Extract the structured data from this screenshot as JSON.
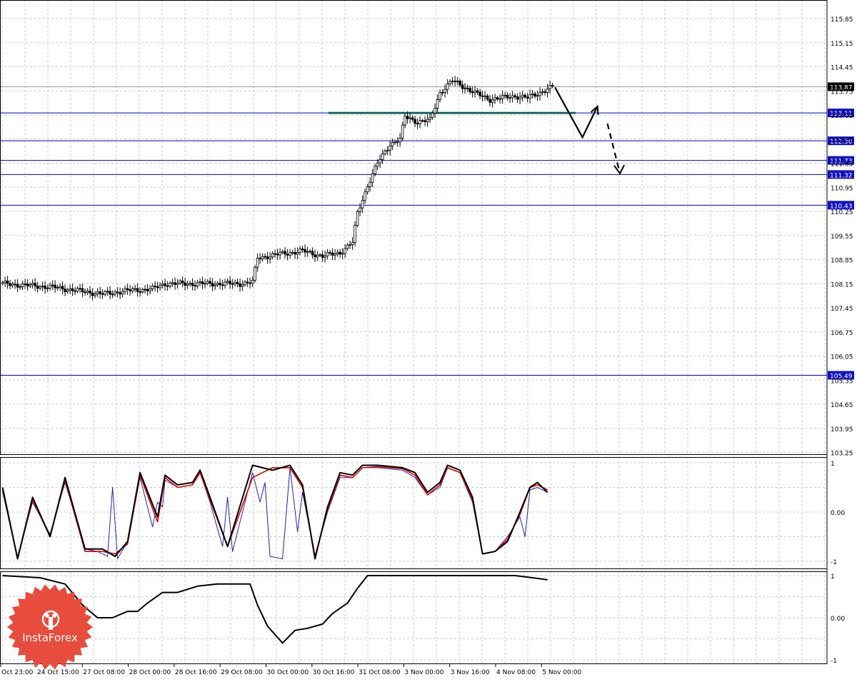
{
  "colors": {
    "grid": "#c8c8c8",
    "level_line": "#0000cc",
    "level_label_bg": "#1010c0",
    "price_label_bg": "#000000",
    "support_zone": "#22aa22",
    "candle": "#000000",
    "stoch_main": "#000000",
    "stoch_fast": "#dd0000",
    "stoch_signal": "#2222aa",
    "logo_badge": "#e84c3d"
  },
  "chart_data": [
    {
      "panel": "price",
      "type": "candlestick",
      "y_ticks": [
        "115.85",
        "115.15",
        "114.45",
        "113.75",
        "113.05",
        "112.35",
        "111.65",
        "110.95",
        "110.25",
        "109.55",
        "108.85",
        "108.15",
        "107.45",
        "106.75",
        "106.05",
        "105.35",
        "104.65",
        "103.95",
        "103.25"
      ],
      "ylim": [
        103.25,
        116.2
      ],
      "current_price": "113.87",
      "horizontal_levels": [
        {
          "label": "113.11",
          "value": 113.11
        },
        {
          "label": "112.30",
          "value": 112.3
        },
        {
          "label": "111.73",
          "value": 111.73
        },
        {
          "label": "111.32",
          "value": 111.32
        },
        {
          "label": "110.43",
          "value": 110.43
        },
        {
          "label": "105.49",
          "value": 105.49
        }
      ],
      "support_zone": {
        "value": 113.11,
        "from_bar": "31 Oct 16:00",
        "to_bar": "5 Nov 00:00"
      },
      "anchors": [
        {
          "i": 0,
          "p": 108.15
        },
        {
          "i": 10,
          "p": 108.1
        },
        {
          "i": 20,
          "p": 108.05
        },
        {
          "i": 30,
          "p": 107.95
        },
        {
          "i": 40,
          "p": 107.85
        },
        {
          "i": 50,
          "p": 107.95
        },
        {
          "i": 60,
          "p": 108.0
        },
        {
          "i": 65,
          "p": 108.15
        },
        {
          "i": 75,
          "p": 108.15
        },
        {
          "i": 85,
          "p": 108.15
        },
        {
          "i": 95,
          "p": 108.15
        },
        {
          "i": 100,
          "p": 108.2
        },
        {
          "i": 102,
          "p": 108.9
        },
        {
          "i": 110,
          "p": 109.0
        },
        {
          "i": 120,
          "p": 109.1
        },
        {
          "i": 128,
          "p": 108.95
        },
        {
          "i": 135,
          "p": 109.05
        },
        {
          "i": 140,
          "p": 109.35
        },
        {
          "i": 142,
          "p": 110.2
        },
        {
          "i": 146,
          "p": 111.0
        },
        {
          "i": 150,
          "p": 111.65
        },
        {
          "i": 155,
          "p": 112.2
        },
        {
          "i": 159,
          "p": 112.35
        },
        {
          "i": 161,
          "p": 113.0
        },
        {
          "i": 166,
          "p": 112.85
        },
        {
          "i": 171,
          "p": 112.9
        },
        {
          "i": 175,
          "p": 113.7
        },
        {
          "i": 180,
          "p": 114.05
        },
        {
          "i": 185,
          "p": 113.85
        },
        {
          "i": 190,
          "p": 113.65
        },
        {
          "i": 195,
          "p": 113.5
        },
        {
          "i": 200,
          "p": 113.55
        },
        {
          "i": 205,
          "p": 113.6
        },
        {
          "i": 210,
          "p": 113.55
        },
        {
          "i": 215,
          "p": 113.7
        },
        {
          "i": 220,
          "p": 113.87
        }
      ],
      "scenario": {
        "solid_path": [
          [
            221,
            113.85
          ],
          [
            232,
            112.4
          ],
          [
            238,
            113.3
          ]
        ],
        "dashed_path": [
          [
            242,
            112.8
          ],
          [
            247,
            111.35
          ]
        ]
      }
    },
    {
      "panel": "stochastic",
      "type": "line",
      "y_ticks": [
        "1",
        "0.00",
        "-1"
      ],
      "ylim": [
        -1,
        1
      ],
      "series": [
        {
          "role": "main",
          "points": [
            [
              0,
              0.5
            ],
            [
              6,
              -0.95
            ],
            [
              12,
              0.3
            ],
            [
              19,
              -0.5
            ],
            [
              25,
              0.7
            ],
            [
              33,
              -0.75
            ],
            [
              40,
              -0.75
            ],
            [
              45,
              -0.9
            ],
            [
              50,
              -0.6
            ],
            [
              55,
              0.8
            ],
            [
              62,
              -0.1
            ],
            [
              65,
              0.75
            ],
            [
              70,
              0.55
            ],
            [
              76,
              0.6
            ],
            [
              79,
              0.85
            ],
            [
              83,
              0.3
            ],
            [
              90,
              -0.7
            ],
            [
              100,
              0.95
            ],
            [
              108,
              0.85
            ],
            [
              115,
              0.95
            ],
            [
              120,
              0.55
            ],
            [
              125,
              -0.95
            ],
            [
              130,
              0.1
            ],
            [
              135,
              0.8
            ],
            [
              140,
              0.75
            ],
            [
              144,
              0.95
            ],
            [
              150,
              0.95
            ],
            [
              160,
              0.9
            ],
            [
              165,
              0.8
            ],
            [
              170,
              0.4
            ],
            [
              175,
              0.6
            ],
            [
              178,
              0.95
            ],
            [
              183,
              0.85
            ],
            [
              188,
              0.3
            ],
            [
              192,
              -0.85
            ],
            [
              197,
              -0.8
            ],
            [
              202,
              -0.6
            ],
            [
              207,
              0.0
            ],
            [
              211,
              0.5
            ],
            [
              214,
              0.6
            ],
            [
              218,
              0.4
            ]
          ]
        },
        {
          "role": "fast",
          "points": [
            [
              0,
              0.45
            ],
            [
              6,
              -0.95
            ],
            [
              12,
              0.25
            ],
            [
              19,
              -0.5
            ],
            [
              25,
              0.65
            ],
            [
              33,
              -0.8
            ],
            [
              40,
              -0.8
            ],
            [
              45,
              -0.85
            ],
            [
              50,
              -0.65
            ],
            [
              55,
              0.75
            ],
            [
              62,
              -0.2
            ],
            [
              65,
              0.7
            ],
            [
              70,
              0.5
            ],
            [
              76,
              0.55
            ],
            [
              79,
              0.8
            ],
            [
              83,
              0.25
            ],
            [
              90,
              -0.7
            ],
            [
              100,
              0.7
            ],
            [
              108,
              0.9
            ],
            [
              115,
              0.9
            ],
            [
              120,
              0.5
            ],
            [
              125,
              -0.9
            ],
            [
              130,
              0.05
            ],
            [
              135,
              0.75
            ],
            [
              140,
              0.7
            ],
            [
              144,
              0.9
            ],
            [
              150,
              0.92
            ],
            [
              160,
              0.88
            ],
            [
              165,
              0.75
            ],
            [
              170,
              0.35
            ],
            [
              175,
              0.55
            ],
            [
              178,
              0.9
            ],
            [
              183,
              0.8
            ],
            [
              188,
              0.25
            ],
            [
              192,
              -0.85
            ],
            [
              197,
              -0.8
            ],
            [
              202,
              -0.55
            ],
            [
              207,
              -0.05
            ],
            [
              211,
              0.5
            ],
            [
              214,
              0.55
            ],
            [
              218,
              0.45
            ]
          ]
        },
        {
          "role": "signal",
          "points": [
            [
              0,
              0.4
            ],
            [
              6,
              -0.9
            ],
            [
              12,
              0.2
            ],
            [
              19,
              -0.45
            ],
            [
              25,
              0.6
            ],
            [
              33,
              -0.75
            ],
            [
              38,
              -0.8
            ],
            [
              42,
              -0.9
            ],
            [
              44,
              0.5
            ],
            [
              46,
              -0.95
            ],
            [
              50,
              -0.6
            ],
            [
              55,
              0.7
            ],
            [
              60,
              -0.3
            ],
            [
              62,
              0.2
            ],
            [
              64,
              0.1
            ],
            [
              65,
              0.65
            ],
            [
              70,
              0.5
            ],
            [
              76,
              0.55
            ],
            [
              79,
              0.8
            ],
            [
              83,
              0.2
            ],
            [
              88,
              -0.7
            ],
            [
              90,
              0.3
            ],
            [
              92,
              -0.8
            ],
            [
              100,
              0.8
            ],
            [
              103,
              0.2
            ],
            [
              105,
              0.6
            ],
            [
              107,
              -0.9
            ],
            [
              112,
              -0.95
            ],
            [
              115,
              0.9
            ],
            [
              118,
              -0.4
            ],
            [
              120,
              0.4
            ],
            [
              125,
              -0.9
            ],
            [
              130,
              0.0
            ],
            [
              135,
              0.7
            ],
            [
              140,
              0.7
            ],
            [
              144,
              0.9
            ],
            [
              150,
              0.9
            ],
            [
              160,
              0.85
            ],
            [
              165,
              0.7
            ],
            [
              170,
              0.35
            ],
            [
              175,
              0.5
            ],
            [
              178,
              0.9
            ],
            [
              183,
              0.8
            ],
            [
              188,
              0.2
            ],
            [
              192,
              -0.85
            ],
            [
              197,
              -0.8
            ],
            [
              202,
              -0.5
            ],
            [
              207,
              -0.1
            ],
            [
              209,
              -0.5
            ],
            [
              211,
              0.45
            ],
            [
              214,
              0.5
            ],
            [
              218,
              0.4
            ]
          ]
        }
      ]
    },
    {
      "panel": "oscillator",
      "type": "line",
      "y_ticks": [
        "1",
        "0.00",
        "-1"
      ],
      "ylim": [
        -1,
        1
      ],
      "series": [
        {
          "role": "line",
          "points": [
            [
              0,
              1.0
            ],
            [
              15,
              0.95
            ],
            [
              25,
              0.8
            ],
            [
              32,
              0.3
            ],
            [
              38,
              0.0
            ],
            [
              44,
              0.0
            ],
            [
              50,
              0.15
            ],
            [
              54,
              0.15
            ],
            [
              58,
              0.35
            ],
            [
              64,
              0.6
            ],
            [
              70,
              0.6
            ],
            [
              78,
              0.75
            ],
            [
              86,
              0.8
            ],
            [
              95,
              0.8
            ],
            [
              99,
              0.8
            ],
            [
              102,
              0.3
            ],
            [
              106,
              -0.2
            ],
            [
              112,
              -0.6
            ],
            [
              117,
              -0.3
            ],
            [
              122,
              -0.25
            ],
            [
              128,
              -0.15
            ],
            [
              132,
              0.1
            ],
            [
              138,
              0.35
            ],
            [
              142,
              0.7
            ],
            [
              146,
              1.0
            ],
            [
              190,
              1.0
            ],
            [
              205,
              1.0
            ],
            [
              212,
              0.95
            ],
            [
              218,
              0.9
            ]
          ]
        }
      ]
    }
  ],
  "x_axis_labels": [
    "Oct 23:00",
    "24 Oct 15:00",
    "27 Oct 08:00",
    "28 Oct 00:00",
    "28 Oct 16:00",
    "29 Oct 08:00",
    "30 Oct 00:00",
    "30 Oct 16:00",
    "31 Oct 08:00",
    "3 Nov 00:00",
    "3 Nov 16:00",
    "4 Nov 08:00",
    "5 Nov 00:00"
  ],
  "logo": {
    "text": "InstaForex"
  }
}
